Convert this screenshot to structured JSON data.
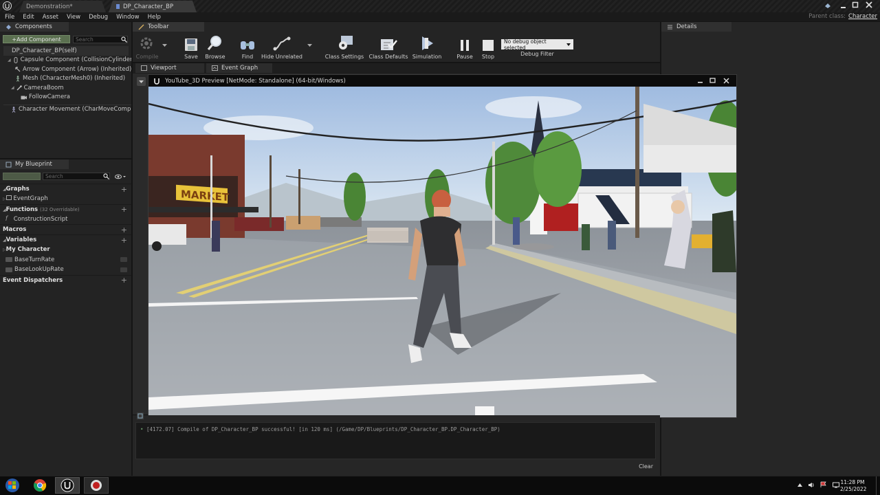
{
  "document_tabs": [
    {
      "label": "Demonstration*",
      "active": false
    },
    {
      "label": "DP_Character_BP",
      "active": true
    }
  ],
  "menu": [
    "File",
    "Edit",
    "Asset",
    "View",
    "Debug",
    "Window",
    "Help"
  ],
  "parent_class": {
    "label": "Parent class:",
    "value": "Character"
  },
  "components_panel": {
    "tab": "Components",
    "add_button": "+Add Component",
    "search_placeholder": "Search",
    "root": "DP_Character_BP(self)",
    "items": [
      "Capsule Component (CollisionCylinder) (Inhe",
      "Arrow Component (Arrow) (Inherited)",
      "Mesh (CharacterMesh0) (Inherited)",
      "CameraBoom",
      "FollowCamera",
      "Character Movement (CharMoveComp) (Inhe"
    ]
  },
  "my_blueprint": {
    "tab": "My Blueprint",
    "search_placeholder": "Search",
    "sections": {
      "graphs": "Graphs",
      "event_graph": "EventGraph",
      "functions": "Functions",
      "functions_note": "(32 Overridable)",
      "construction_script": "ConstructionScript",
      "macros": "Macros",
      "variables": "Variables",
      "my_character": "My Character",
      "var1": "BaseTurnRate",
      "var2": "BaseLookUpRate",
      "event_dispatchers": "Event Dispatchers"
    }
  },
  "toolbar": {
    "tab": "Toolbar",
    "compile": "Compile",
    "save": "Save",
    "browse": "Browse",
    "find": "Find",
    "hide_unrelated": "Hide Unrelated",
    "class_settings": "Class Settings",
    "class_defaults": "Class Defaults",
    "simulation": "Simulation",
    "pause": "Pause",
    "stop": "Stop",
    "debug_select": "No debug object selected",
    "debug_filter": "Debug Filter"
  },
  "editor_tabs": {
    "viewport": "Viewport",
    "event_graph": "Event Graph"
  },
  "details_tab": "Details",
  "pie_window": {
    "title": "YouTube_3D Preview [NetMode: Standalone]  (64-bit/Windows)"
  },
  "compiler_log": {
    "message": "[4172.07] Compile of DP_Character_BP successful! [in 120 ms] (/Game/DP/Blueprints/DP_Character_BP.DP_Character_BP)",
    "clear": "Clear"
  },
  "taskbar": {
    "time": "11:28 PM",
    "date": "2/25/2022"
  },
  "scene_sign": "MARKET"
}
